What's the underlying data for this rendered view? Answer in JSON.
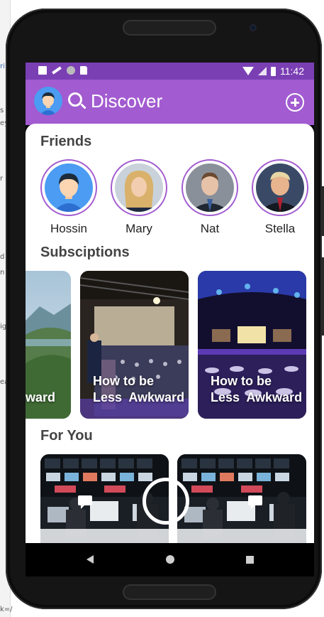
{
  "background_text": [
    "ri",
    "s",
    "ey",
    "r",
    "d",
    "n",
    "ig",
    "ea",
    "k=/"
  ],
  "statusbar": {
    "time": "11:42"
  },
  "appbar": {
    "title": "Discover"
  },
  "sections": {
    "friends": "Friends",
    "subscriptions": "Subsciptions",
    "for_you": "For You"
  },
  "friends": [
    {
      "name": "Hossin"
    },
    {
      "name": "Mary"
    },
    {
      "name": "Nat"
    },
    {
      "name": "Stella"
    }
  ],
  "subscriptions": [
    {
      "title": "ward"
    },
    {
      "title": "How to be\nLess  Awkward"
    },
    {
      "title": "How to be\nLess  Awkward"
    }
  ],
  "colors": {
    "status_bar": "#7b3fb4",
    "app_bar": "#a25bd0",
    "ring": "#a25bd0"
  }
}
